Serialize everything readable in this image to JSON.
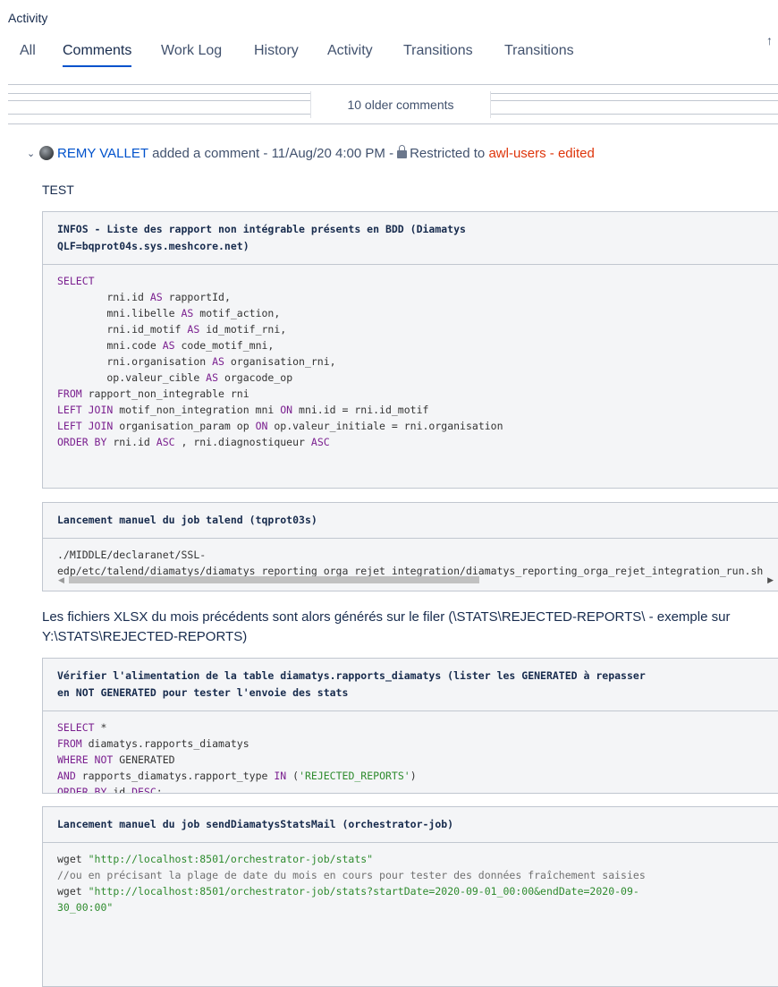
{
  "section_title": "Activity",
  "tabs": [
    "All",
    "Comments",
    "Work Log",
    "History",
    "Activity",
    "Transitions",
    "Transitions"
  ],
  "active_tab": "Comments",
  "older_comments": "10 older comments",
  "comment": {
    "author": "REMY VALLET",
    "action": "added a comment -",
    "timestamp": "11/Aug/20 4:00 PM",
    "dash": "-",
    "restricted_label": "Restricted to",
    "group": "awl-users",
    "edited_sep": "-",
    "edited": "edited",
    "first_line": "TEST",
    "panels": [
      {
        "title": "INFOS - Liste des rapport non intégrable présents en BDD (Diamatys\nQLF=bqprot04s.sys.meshcore.net)",
        "lines": [
          [
            [
              "kw",
              "SELECT"
            ]
          ],
          [
            [
              "",
              "        rni.id "
            ],
            [
              "kw",
              "AS"
            ],
            [
              "",
              " rapportId,"
            ]
          ],
          [
            [
              "",
              "        mni.libelle "
            ],
            [
              "kw",
              "AS"
            ],
            [
              "",
              " motif_action,"
            ]
          ],
          [
            [
              "",
              "        rni.id_motif "
            ],
            [
              "kw",
              "AS"
            ],
            [
              "",
              " id_motif_rni,"
            ]
          ],
          [
            [
              "",
              "        mni.code "
            ],
            [
              "kw",
              "AS"
            ],
            [
              "",
              " code_motif_mni,"
            ]
          ],
          [
            [
              "",
              "        rni.organisation "
            ],
            [
              "kw",
              "AS"
            ],
            [
              "",
              " organisation_rni,"
            ]
          ],
          [
            [
              "",
              "        op.valeur_cible "
            ],
            [
              "kw",
              "AS"
            ],
            [
              "",
              " orgacode_op"
            ]
          ],
          [
            [
              "kw",
              "FROM"
            ],
            [
              "",
              " rapport_non_integrable rni"
            ]
          ],
          [
            [
              "kw",
              "LEFT JOIN"
            ],
            [
              "",
              " motif_non_integration mni "
            ],
            [
              "kw",
              "ON"
            ],
            [
              "",
              " mni.id = rni.id_motif"
            ]
          ],
          [
            [
              "kw",
              "LEFT JOIN"
            ],
            [
              "",
              " organisation_param op "
            ],
            [
              "kw",
              "ON"
            ],
            [
              "",
              " op.valeur_initiale = rni.organisation"
            ]
          ],
          [
            [
              "kw",
              "ORDER BY"
            ],
            [
              "",
              " rni.id "
            ],
            [
              "kw",
              "ASC"
            ],
            [
              "",
              " , rni.diagnostiqueur "
            ],
            [
              "kw",
              "ASC"
            ]
          ]
        ]
      },
      {
        "title": "Lancement manuel du job talend (tqprot03s)",
        "lines": [
          [
            [
              "",
              "./MIDDLE/declaranet/SSL-"
            ]
          ],
          [
            [
              "",
              "edp/etc/talend/diamatys/diamatys_reporting_orga_rejet_integration/diamatys_reporting_orga_rejet_integration_run.sh"
            ]
          ]
        ]
      },
      {
        "title": "Vérifier l'alimentation de la table diamatys.rapports_diamatys (lister les GENERATED à repasser\nen NOT GENERATED pour tester l'envoie des stats",
        "lines": [
          [
            [
              "kw",
              "SELECT"
            ],
            [
              "",
              " *"
            ]
          ],
          [
            [
              "kw",
              "FROM"
            ],
            [
              "",
              " diamatys.rapports_diamatys"
            ]
          ],
          [
            [
              "kw",
              "WHERE NOT"
            ],
            [
              "",
              " GENERATED"
            ]
          ],
          [
            [
              "kw",
              "AND"
            ],
            [
              "",
              " rapports_diamatys.rapport_type "
            ],
            [
              "kw",
              "IN"
            ],
            [
              "",
              " ("
            ],
            [
              "str",
              "'REJECTED_REPORTS'"
            ],
            [
              "",
              ")"
            ]
          ],
          [
            [
              "kw",
              "ORDER BY"
            ],
            [
              "",
              " id "
            ],
            [
              "kw",
              "DESC"
            ],
            [
              "",
              ";"
            ]
          ]
        ]
      },
      {
        "title": "Lancement manuel du job sendDiamatysStatsMail (orchestrator-job)",
        "lines": [
          [
            [
              "",
              "wget "
            ],
            [
              "str",
              "\"http://localhost:8501/orchestrator-job/stats\""
            ]
          ],
          [
            [
              "cm",
              "//ou en précisant la plage de date du mois en cours pour tester des données fraîchement saisies"
            ]
          ],
          [
            [
              "",
              "wget "
            ],
            [
              "str",
              "\"http://localhost:8501/orchestrator-job/stats?startDate=2020-09-01_00:00&endDate=2020-09-"
            ]
          ],
          [
            [
              "str",
              "30_00:00\""
            ]
          ]
        ]
      }
    ],
    "paragraph": "Les fichiers XLSX du mois précédents sont alors générés sur le filer (\\STATS\\REJECTED-REPORTS\\ - exemple sur Y:\\STATS\\REJECTED-REPORTS)"
  },
  "icons": {
    "sort": "sort-arrow-icon",
    "expand": "chevron-down-icon",
    "lock": "lock-icon",
    "avatar": "user-avatar-icon",
    "scroll_left": "scroll-left-icon",
    "scroll_right": "scroll-right-icon"
  },
  "colors": {
    "link": "#0052cc",
    "group": "#de350b",
    "keyword": "#7a1f8f",
    "string": "#2e8b2e",
    "active_tab_underline": "#0052cc"
  }
}
